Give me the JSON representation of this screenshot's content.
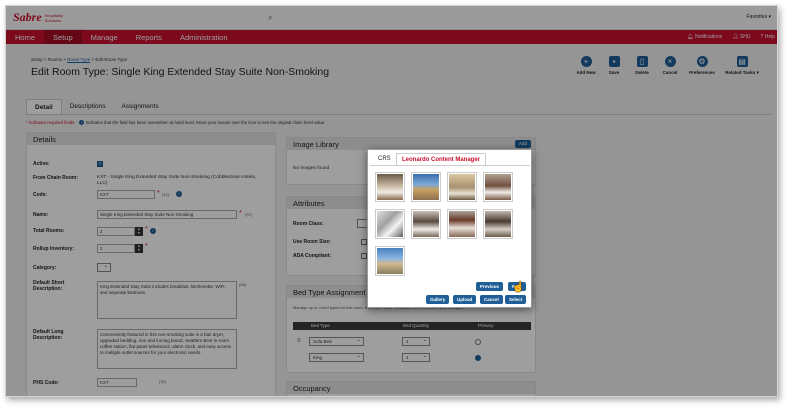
{
  "topbar": {
    "brand": "Sabre",
    "brand_sub": "Hospitality Solutions",
    "favorites": "Favorites ▾"
  },
  "nav": {
    "items": [
      "Home",
      "Setup",
      "Manage",
      "Reports",
      "Administration"
    ],
    "active": "Setup",
    "notifications": "Notifications",
    "shu": "SHU",
    "help": "Help"
  },
  "header": {
    "breadcrumb": {
      "prefix": "Setup > Rooms > ",
      "link": "Room Type",
      "suffix": " > Edit Room Type"
    },
    "title": "Edit Room Type: Single King Extended Stay Suite Non-Smoking"
  },
  "toolbar": {
    "add_new": "Add New",
    "save": "Save",
    "delete": "Delete",
    "cancel": "Cancel",
    "preferences": "Preferences",
    "related_tasks": "Related Tasks ▾"
  },
  "tabs": [
    "Detail",
    "Descriptions",
    "Assignments"
  ],
  "legend": {
    "required": "* Indicates required fields",
    "overwrite": "Indicates that the field has been overwritten at hotel level. Move your mouse over the icon to see the original chain level value."
  },
  "details": {
    "title": "Details",
    "active_label": "Active:",
    "chain_room_label": "From Chain Room:",
    "chain_room_value": "KXT - Single King Extended Stay Suite Non-Smoking (Cobblestone Hotels, LLC)",
    "code_label": "Code:",
    "code_value": "KXT",
    "code_count": "(12)",
    "name_label": "Name:",
    "name_value": "Single King Extended Stay Suite Non-Smoking",
    "name_count": "(37)",
    "total_rooms_label": "Total Rooms:",
    "total_rooms_value": "2",
    "rollup_label": "Rollup Inventory:",
    "rollup_value": "2",
    "category_label": "Category:",
    "short_desc_label": "Default Short Description:",
    "short_desc_value": "King Extended Stay Suite includes breakfast, kitchenette, WiFi, and separate bedroom.",
    "short_desc_count": "(94)",
    "long_desc_label": "Default Long Description:",
    "long_desc_value": "Conveniently featured in this non-smoking suite is a hair dryer, upgraded bedding, iron and ironing board, Seattle's Best in-room coffee station, flat panel televisions, alarm clock, and easy access to multiple outlet sources for your electronic needs.",
    "phs_label": "PHS Code:",
    "phs_value": "KXT",
    "phs_count": "(32)"
  },
  "image_library": {
    "title": "Image Library",
    "add": "Add",
    "empty": "No images found"
  },
  "attributes": {
    "title": "Attributes",
    "room_class": "Room Class:",
    "use_room_size": "Use Room Size:",
    "ada": "ADA Compliant:"
  },
  "bed_type": {
    "title": "Bed Type Assignment",
    "hint": "Manage up to 4 bed types for this room, then click 'Save' to update the room with these changes.",
    "col_bed": "Bed Type",
    "col_qty": "Bed Quantity",
    "col_primary": "Primary",
    "rows": [
      {
        "bed": "Sofa Bed",
        "qty": "1"
      },
      {
        "bed": "King",
        "qty": "1"
      }
    ]
  },
  "occupancy": {
    "title": "Occupancy"
  },
  "modal": {
    "tab_crs": "CRS",
    "tab_lcm": "Leonardo Content Manager",
    "previous": "Previous",
    "next": "Next",
    "gallery": "Gallery",
    "upload": "Upload",
    "cancel": "Cancel",
    "select": "Select"
  },
  "colors": {
    "brand_red": "#c8102e",
    "action_blue": "#1f5e96"
  }
}
